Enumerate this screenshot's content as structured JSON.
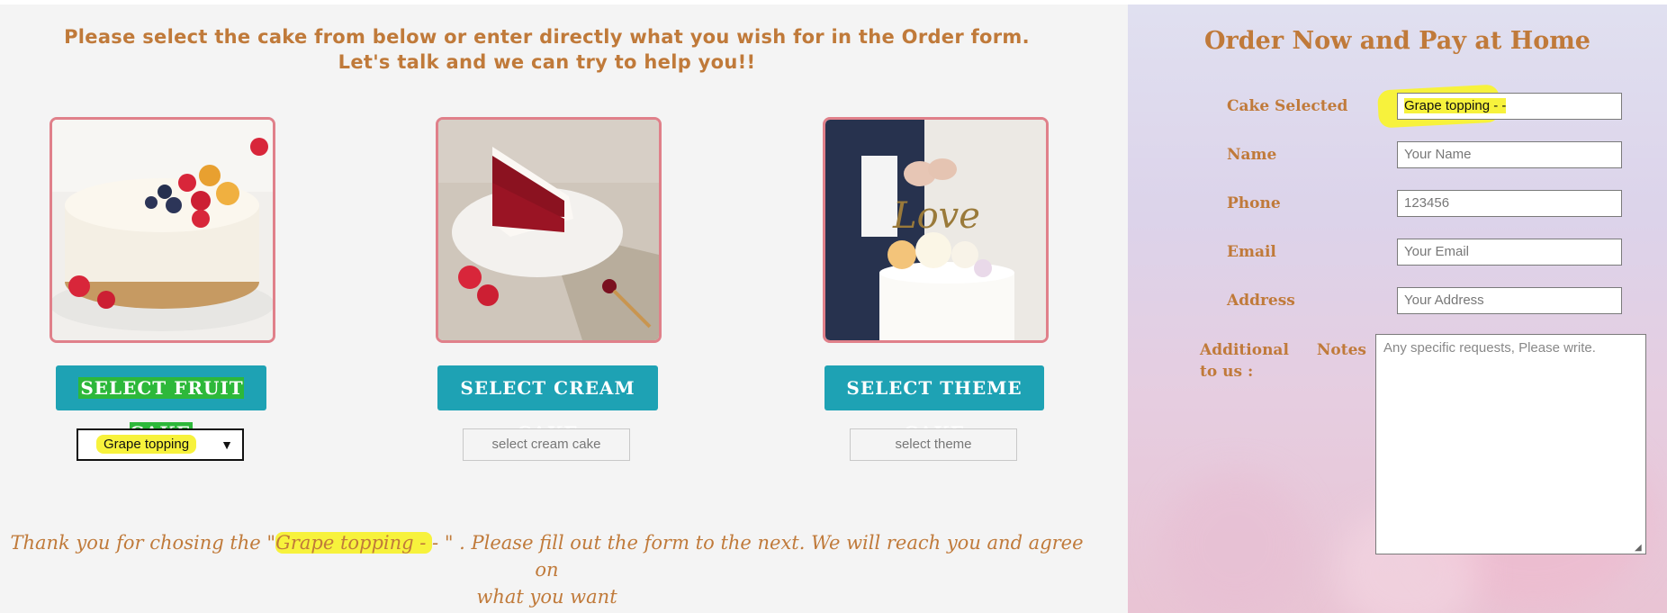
{
  "intro": {
    "line1": "Please select the cake from below or enter directly what you wish for in the Order form.",
    "line2": "Let's talk and we can try to help you!!"
  },
  "cards": [
    {
      "button": "SELECT FRUIT CAKE",
      "dropdown": "Grape topping",
      "image": "fruit-cake-photo"
    },
    {
      "button": "SELECT CREAM CAKE",
      "dropdown": "select cream cake",
      "image": "red-velvet-slice-photo"
    },
    {
      "button": "SELECT THEME CAKE",
      "dropdown": "select theme",
      "image": "wedding-cake-photo"
    }
  ],
  "thanks": {
    "prefix": "Thank you for chosing the \"",
    "choice": "Grape topping - ",
    "suffix": "- \" . Please fill out the form to the next. We will reach you and agree on",
    "line2": "what you want"
  },
  "form": {
    "title": "Order Now and Pay at Home",
    "cake_label": "Cake Selected",
    "cake_value": "Grape topping -  -",
    "name_label": "Name",
    "name_placeholder": "Your Name",
    "phone_label": "Phone",
    "phone_value": "123456",
    "email_label": "Email",
    "email_placeholder": "Your Email",
    "address_label": "Address",
    "address_placeholder": "Your Address",
    "notes_label": "Additional Notes to us :",
    "notes_placeholder": "Any specific requests, Please write."
  },
  "colors": {
    "accent_text": "#c07a3a",
    "button_bg": "#1ea2b4",
    "card_border": "#e0808a",
    "highlight": "#f7f23c"
  }
}
